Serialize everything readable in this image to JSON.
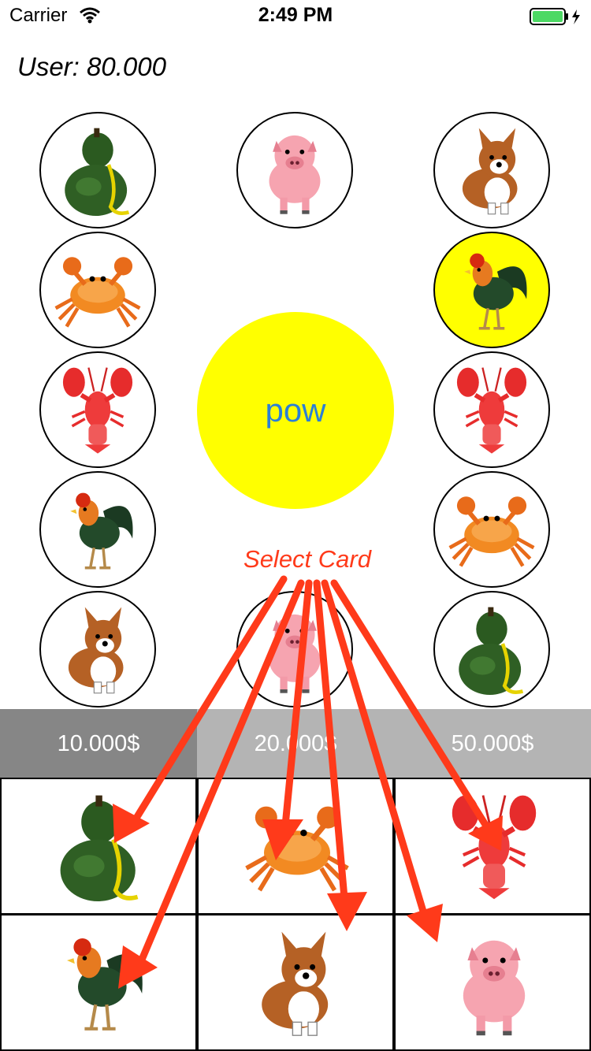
{
  "status_bar": {
    "carrier": "Carrier",
    "time": "2:49 PM"
  },
  "user": {
    "label": "User: 80.000"
  },
  "board": {
    "top": [
      "gourd",
      "pig",
      "dog"
    ],
    "left": [
      "crab",
      "lobster",
      "rooster",
      "dog"
    ],
    "right": [
      "rooster",
      "lobster",
      "crab",
      "gourd"
    ],
    "bottom_center": "pig",
    "highlighted": "right-rooster"
  },
  "pow_button": {
    "label": "pow"
  },
  "select_card": {
    "label": "Select Card"
  },
  "bets": [
    {
      "label": "10.000$",
      "selected": true
    },
    {
      "label": "20.000$",
      "selected": false
    },
    {
      "label": "50.000$",
      "selected": false
    }
  ],
  "cards": [
    "gourd",
    "crab",
    "lobster",
    "rooster",
    "dog",
    "pig"
  ],
  "colors": {
    "highlight": "#ffff00",
    "pow_text": "#2b7fd6",
    "annotation": "#ff3a1a",
    "bet_active": "#868686",
    "bet_inactive": "#b4b4b4"
  }
}
